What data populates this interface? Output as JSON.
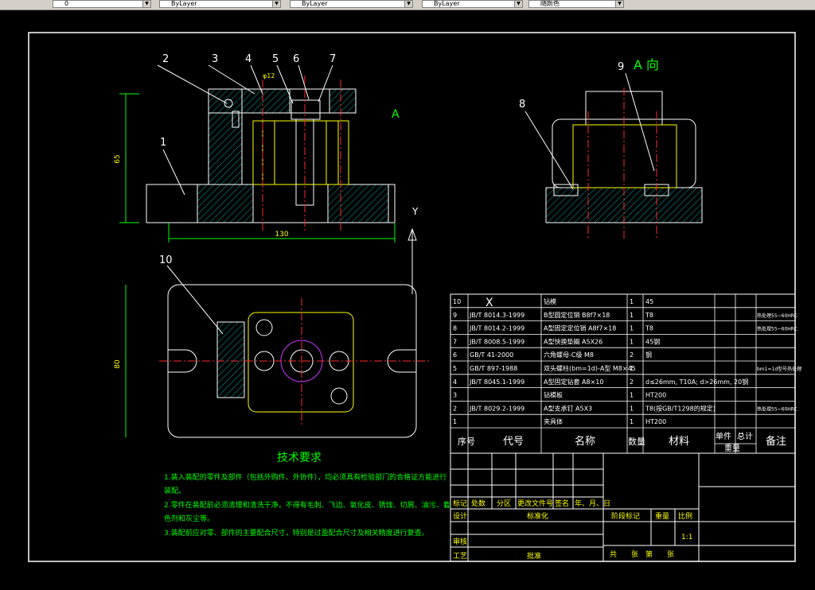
{
  "toolbar": {
    "layer_combo": "0",
    "color_combo": "ByLayer",
    "linetype_combo": "ByLayer",
    "lineweight_combo": "ByLayer",
    "plotstyle_combo": "随颜色"
  },
  "drawing": {
    "balloons": [
      "1",
      "2",
      "3",
      "4",
      "5",
      "6",
      "7",
      "8",
      "9",
      "10"
    ],
    "view_label_a": "A",
    "view_title": "A 向",
    "dim_width": "130",
    "dim_height_front": "65",
    "dim_height_top": "80",
    "dim_phi12": "φ12",
    "axis_y": "Y",
    "axis_x": "X",
    "tech_title": "技术要求",
    "tech_lines": [
      "1.装入装配的零件及部件（包括外购件、外协件），均必须具有检验部门的合格证方能进行",
      "装配。",
      "2.零件在装配前必须清理和清洗干净，不得有毛刺、飞边、氧化皮、锈蚀、切屑、油污、着",
      "色剂和灰尘等。",
      "3.装配前应对零、部件的主要配合尺寸，特别是过盈配合尺寸及相关精度进行复查。"
    ]
  },
  "bom": {
    "rows": [
      {
        "no": "10",
        "code": "",
        "name": "钻模",
        "qty": "1",
        "mat": "45",
        "note": ""
      },
      {
        "no": "9",
        "code": "JB/T 8014.3-1999",
        "name": "B型圆定位销 B8f7×18",
        "qty": "1",
        "mat": "T8",
        "note": "热处理55~60HRC"
      },
      {
        "no": "8",
        "code": "JB/T 8014.2-1999",
        "name": "A型固定定位销 A8f7×18",
        "qty": "1",
        "mat": "T8",
        "note": "热处理55~60HRC"
      },
      {
        "no": "7",
        "code": "JB/T 8008.5-1999",
        "name": "A型快换垫圈 A5X26",
        "qty": "1",
        "mat": "45钢",
        "note": ""
      },
      {
        "no": "6",
        "code": "GB/T 41-2000",
        "name": "六角螺母-C级 M8",
        "qty": "2",
        "mat": "钢",
        "note": ""
      },
      {
        "no": "5",
        "code": "GB/T 897-1988",
        "name": "双头螺柱(bm=1d)-A型 M8×45",
        "qty": "1",
        "mat": "",
        "note": "bm1=1d型号热处理"
      },
      {
        "no": "4",
        "code": "JB/T 8045.1-1999",
        "name": "A型固定钻套 A8×10",
        "qty": "2",
        "mat": "d≤26mm, T10A; d>26mm, 20钢",
        "note": ""
      },
      {
        "no": "3",
        "code": "",
        "name": "钻模板",
        "qty": "1",
        "mat": "HT200",
        "note": ""
      },
      {
        "no": "2",
        "code": "JB/T 8029.2-1999",
        "name": "A型支承钉 A5X3",
        "qty": "1",
        "mat": "T8(按GB/T1298的规定)",
        "note": "热处理55~60HRC"
      },
      {
        "no": "1",
        "code": "",
        "name": "夹具体",
        "qty": "1",
        "mat": "HT200",
        "note": ""
      }
    ],
    "header": {
      "no": "序号",
      "code": "代号",
      "name": "名称",
      "qty": "数量",
      "mat": "材料",
      "unit": "单件",
      "total": "总计",
      "weight": "重量",
      "note": "备注"
    }
  },
  "title_block": {
    "mark": "标记",
    "count": "处数",
    "zone": "分区",
    "docno": "更改文件号",
    "sign": "签名",
    "date": "年、月、日",
    "design": "设计",
    "standard": "标准化",
    "stage": "阶段标记",
    "weight": "重量",
    "scale": "比例",
    "scale_value": "1:1",
    "check": "审核",
    "process": "工艺",
    "approve": "批准",
    "sheets": "共　　张　第　　张"
  },
  "colors": {
    "frame": "#ffffff",
    "green": "#00ff00",
    "yellow": "#ffff00",
    "red": "#ff2a2a",
    "hatch": "#00e0e0",
    "magenta": "#cc33ff"
  }
}
